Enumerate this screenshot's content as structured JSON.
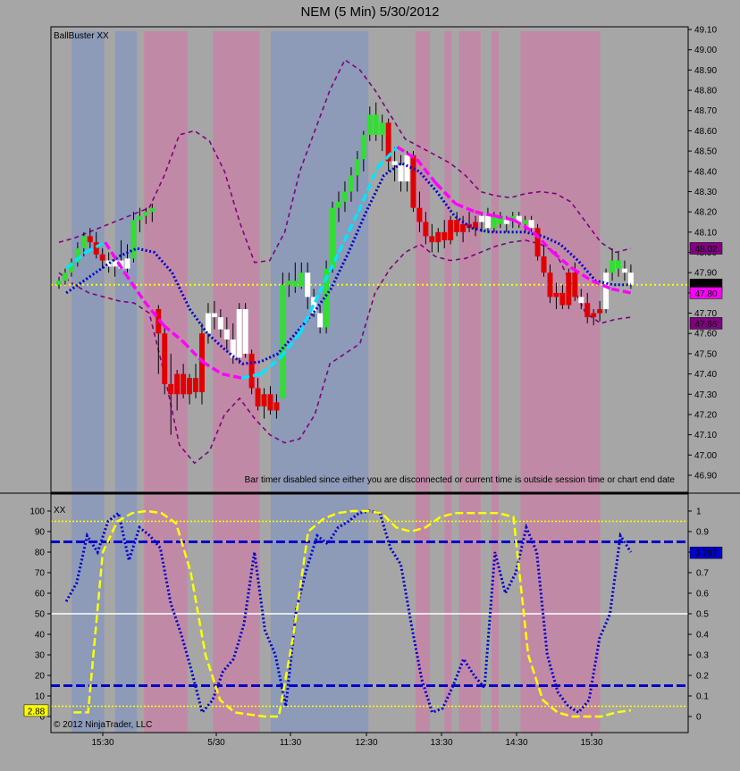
{
  "window": {
    "title": "NEM (5 Min)  5/30/2012"
  },
  "colors": {
    "background": "#a6a6a6",
    "band_blue": "#8d9ab8",
    "band_red": "#c08aa6",
    "candle_up_green": "#33dd33",
    "candle_down_red": "#e00000",
    "candle_neutral_white": "#ffffff",
    "bollinger_purple": "#800080",
    "ma_magenta": "#ff00ff",
    "ma_cyan": "#00e5ff",
    "ma_blue": "#0000cc",
    "price_line_yellow": "#ffff00",
    "oscillator_yellow": "#ffff00",
    "oscillator_blue": "#0000cc"
  },
  "chart_data": [
    {
      "type": "candlestick",
      "label": "BallBuster XX",
      "y_axis": {
        "range": [
          46.8,
          49.1
        ],
        "ticks": [
          "49.10",
          "49.00",
          "48.90",
          "48.80",
          "48.70",
          "48.60",
          "48.50",
          "48.40",
          "48.30",
          "48.20",
          "48.10",
          "48.00",
          "47.90",
          "47.80",
          "47.70",
          "47.60",
          "47.50",
          "47.40",
          "47.30",
          "47.20",
          "47.10",
          "47.00",
          "46.90"
        ]
      },
      "price_labels": [
        {
          "text": "48.02",
          "value": 48.02,
          "color": "#800080"
        },
        {
          "text": "47.84",
          "value": 47.84,
          "color": "#000000"
        },
        {
          "text": "47.80",
          "value": 47.8,
          "color": "#ff00ff"
        },
        {
          "text": "47.65",
          "value": 47.65,
          "color": "#800080"
        }
      ],
      "horizontal_line": {
        "value": 47.84,
        "style": "dotted",
        "color": "#ffff00"
      },
      "note": "Bar timer disabled since either you are disconnected or current time is outside session time or chart end date",
      "session_bands": [
        {
          "from_bar": 4,
          "to_bar": 12,
          "color": "blue"
        },
        {
          "from_bar": 16,
          "to_bar": 21,
          "color": "blue"
        },
        {
          "from_bar": 24,
          "to_bar": 35,
          "color": "red"
        },
        {
          "from_bar": 43,
          "to_bar": 55,
          "color": "red"
        },
        {
          "from_bar": 59,
          "to_bar": 85,
          "color": "blue"
        },
        {
          "from_bar": 99,
          "to_bar": 102,
          "color": "red"
        },
        {
          "from_bar": 107,
          "to_bar": 108,
          "color": "red"
        },
        {
          "from_bar": 111,
          "to_bar": 116,
          "color": "red"
        },
        {
          "from_bar": 120,
          "to_bar": 121,
          "color": "red"
        },
        {
          "from_bar": 128,
          "to_bar": 149,
          "color": "red"
        }
      ],
      "candles": [
        [
          47.84,
          47.88,
          47.82,
          47.86,
          "g"
        ],
        [
          47.86,
          47.92,
          47.84,
          47.9,
          "g"
        ],
        [
          47.9,
          47.97,
          47.88,
          47.95,
          "g"
        ],
        [
          47.95,
          48.05,
          47.93,
          48.02,
          "g"
        ],
        [
          48.02,
          48.1,
          47.98,
          48.08,
          "g"
        ],
        [
          48.08,
          48.12,
          48.02,
          48.05,
          "r"
        ],
        [
          48.05,
          48.1,
          47.97,
          47.99,
          "r"
        ],
        [
          47.99,
          48.02,
          47.92,
          47.96,
          "r"
        ],
        [
          47.96,
          48.0,
          47.9,
          47.93,
          "w"
        ],
        [
          47.93,
          47.98,
          47.88,
          47.96,
          "w"
        ],
        [
          47.96,
          48.06,
          47.92,
          47.92,
          "w"
        ],
        [
          47.92,
          48.04,
          47.9,
          47.97,
          "w"
        ],
        [
          47.97,
          48.2,
          47.95,
          48.16,
          "g"
        ],
        [
          48.16,
          48.22,
          48.1,
          48.18,
          "g"
        ],
        [
          48.18,
          48.22,
          48.14,
          48.2,
          "g"
        ],
        [
          48.2,
          48.24,
          48.15,
          48.22,
          "g"
        ],
        [
          47.72,
          47.74,
          47.4,
          47.6,
          "r"
        ],
        [
          47.6,
          47.63,
          47.3,
          47.35,
          "r"
        ],
        [
          47.35,
          47.5,
          47.1,
          47.3,
          "r"
        ],
        [
          47.3,
          47.42,
          47.22,
          47.4,
          "r"
        ],
        [
          47.4,
          47.45,
          47.28,
          47.3,
          "r"
        ],
        [
          47.3,
          47.4,
          47.25,
          47.38,
          "r"
        ],
        [
          47.38,
          47.45,
          47.28,
          47.31,
          "r"
        ],
        [
          47.31,
          47.65,
          47.25,
          47.6,
          "r"
        ],
        [
          47.6,
          47.75,
          47.55,
          47.7,
          "w"
        ],
        [
          47.7,
          47.76,
          47.62,
          47.68,
          "w"
        ],
        [
          47.68,
          47.72,
          47.58,
          47.62,
          "w"
        ],
        [
          47.62,
          47.68,
          47.52,
          47.57,
          "w"
        ],
        [
          47.57,
          47.65,
          47.45,
          47.48,
          "w"
        ],
        [
          47.48,
          47.75,
          47.45,
          47.72,
          "w"
        ],
        [
          47.72,
          47.75,
          47.48,
          47.5,
          "w"
        ],
        [
          47.5,
          47.52,
          47.3,
          47.33,
          "r"
        ],
        [
          47.33,
          47.38,
          47.22,
          47.24,
          "r"
        ],
        [
          47.24,
          47.33,
          47.18,
          47.3,
          "r"
        ],
        [
          47.3,
          47.34,
          47.2,
          47.22,
          "r"
        ],
        [
          47.22,
          47.3,
          47.18,
          47.26,
          "r"
        ],
        [
          47.28,
          47.9,
          47.28,
          47.84,
          "g"
        ],
        [
          47.84,
          47.9,
          47.78,
          47.86,
          "g"
        ],
        [
          47.86,
          47.95,
          47.8,
          47.83,
          "g"
        ],
        [
          47.83,
          47.95,
          47.82,
          47.9,
          "g"
        ],
        [
          47.9,
          47.95,
          47.72,
          47.78,
          "w"
        ],
        [
          47.78,
          47.82,
          47.68,
          47.7,
          "w"
        ],
        [
          47.7,
          47.74,
          47.6,
          47.63,
          "w"
        ],
        [
          47.63,
          47.96,
          47.6,
          47.92,
          "g"
        ],
        [
          47.92,
          48.25,
          47.9,
          48.22,
          "g"
        ],
        [
          48.22,
          48.3,
          48.15,
          48.25,
          "g"
        ],
        [
          48.25,
          48.35,
          48.2,
          48.3,
          "g"
        ],
        [
          48.3,
          48.42,
          48.25,
          48.38,
          "g"
        ],
        [
          48.38,
          48.5,
          48.3,
          48.46,
          "g"
        ],
        [
          48.46,
          48.6,
          48.4,
          48.58,
          "g"
        ],
        [
          48.58,
          48.72,
          48.55,
          48.68,
          "g"
        ],
        [
          48.68,
          48.74,
          48.55,
          48.58,
          "g"
        ],
        [
          48.58,
          48.68,
          48.5,
          48.64,
          "g"
        ],
        [
          48.64,
          48.66,
          48.4,
          48.45,
          "r"
        ],
        [
          48.45,
          48.52,
          48.35,
          48.43,
          "w"
        ],
        [
          48.43,
          48.48,
          48.3,
          48.35,
          "w"
        ],
        [
          48.35,
          48.5,
          48.3,
          48.48,
          "w"
        ],
        [
          48.48,
          48.5,
          48.2,
          48.22,
          "r"
        ],
        [
          48.22,
          48.3,
          48.1,
          48.15,
          "r"
        ],
        [
          48.15,
          48.2,
          48.04,
          48.08,
          "r"
        ],
        [
          48.08,
          48.14,
          48.0,
          48.05,
          "r"
        ],
        [
          48.05,
          48.12,
          48.0,
          48.1,
          "r"
        ],
        [
          48.1,
          48.16,
          48.02,
          48.06,
          "r"
        ],
        [
          48.06,
          48.18,
          48.04,
          48.16,
          "r"
        ],
        [
          48.16,
          48.2,
          48.08,
          48.1,
          "r"
        ],
        [
          48.1,
          48.18,
          48.05,
          48.14,
          "r"
        ],
        [
          48.14,
          48.2,
          48.1,
          48.12,
          "r"
        ],
        [
          48.12,
          48.18,
          48.08,
          48.15,
          "r"
        ],
        [
          48.15,
          48.2,
          48.1,
          48.18,
          "w"
        ],
        [
          48.18,
          48.22,
          48.1,
          48.12,
          "w"
        ],
        [
          48.12,
          48.2,
          48.1,
          48.18,
          "g"
        ],
        [
          48.18,
          48.2,
          48.12,
          48.14,
          "g"
        ],
        [
          48.14,
          48.18,
          48.1,
          48.16,
          "w"
        ],
        [
          48.16,
          48.2,
          48.12,
          48.18,
          "g"
        ],
        [
          48.18,
          48.2,
          48.12,
          48.14,
          "w"
        ],
        [
          48.14,
          48.18,
          48.1,
          48.16,
          "g"
        ],
        [
          48.16,
          48.18,
          48.1,
          48.12,
          "w"
        ],
        [
          48.12,
          48.14,
          47.96,
          47.98,
          "r"
        ],
        [
          47.98,
          48.04,
          47.88,
          47.9,
          "r"
        ],
        [
          47.9,
          47.94,
          47.75,
          47.78,
          "r"
        ],
        [
          47.78,
          47.85,
          47.72,
          47.8,
          "r"
        ],
        [
          47.8,
          47.84,
          47.72,
          47.74,
          "r"
        ],
        [
          47.74,
          47.92,
          47.72,
          47.9,
          "r"
        ],
        [
          47.9,
          47.95,
          47.76,
          47.78,
          "r"
        ],
        [
          47.78,
          47.82,
          47.72,
          47.75,
          "w"
        ],
        [
          47.75,
          47.8,
          47.65,
          47.68,
          "r"
        ],
        [
          47.68,
          47.72,
          47.64,
          47.7,
          "r"
        ],
        [
          47.7,
          47.76,
          47.66,
          47.72,
          "r"
        ],
        [
          47.72,
          47.92,
          47.7,
          47.9,
          "w"
        ],
        [
          47.9,
          48.02,
          47.86,
          47.96,
          "g"
        ],
        [
          47.96,
          48.0,
          47.88,
          47.92,
          "g"
        ],
        [
          47.92,
          47.96,
          47.86,
          47.9,
          "w"
        ],
        [
          47.9,
          47.94,
          47.82,
          47.84,
          "w"
        ]
      ],
      "bollinger_upper": [
        48.05,
        48.07,
        48.1,
        48.13,
        48.16,
        48.19,
        48.22,
        48.38,
        48.58,
        48.6,
        48.55,
        48.4,
        48.15,
        47.95,
        47.96,
        48.1,
        48.4,
        48.6,
        48.8,
        48.95,
        48.9,
        48.8,
        48.68,
        48.56,
        48.52,
        48.48,
        48.44,
        48.38,
        48.3,
        48.28,
        48.27,
        48.29,
        48.3,
        48.29,
        48.25,
        48.15,
        48.05,
        48.0,
        48.02
      ],
      "bollinger_lower": [
        47.9,
        47.84,
        47.8,
        47.78,
        47.76,
        47.75,
        47.7,
        47.4,
        47.05,
        46.96,
        47.02,
        47.2,
        47.28,
        47.18,
        47.1,
        47.06,
        47.08,
        47.2,
        47.45,
        47.5,
        47.55,
        47.8,
        47.92,
        48.0,
        48.04,
        47.98,
        47.96,
        47.97,
        48.0,
        48.03,
        48.05,
        48.06,
        48.04,
        48.0,
        47.85,
        47.7,
        47.65,
        47.67,
        47.68
      ],
      "ma_blue": [
        47.8,
        47.86,
        47.92,
        47.98,
        48.02,
        48.0,
        47.9,
        47.72,
        47.6,
        47.52,
        47.45,
        47.46,
        47.5,
        47.6,
        47.7,
        47.82,
        48.0,
        48.2,
        48.38,
        48.44,
        48.4,
        48.3,
        48.18,
        48.12,
        48.1,
        48.1,
        48.1,
        48.08,
        48.04,
        47.96,
        47.86,
        47.84,
        47.84
      ],
      "ma_pink": [
        47.92,
        48.0,
        48.05,
        47.9,
        47.76,
        47.64,
        47.56,
        47.46,
        47.4,
        47.38,
        47.4,
        47.48,
        47.6,
        47.8,
        48.0,
        48.2,
        48.42,
        48.52,
        48.46,
        48.34,
        48.24,
        48.2,
        48.18,
        48.16,
        48.1,
        48.0,
        47.92,
        47.86,
        47.82,
        47.8
      ]
    },
    {
      "type": "line",
      "label": "XX",
      "left_axis": {
        "range": [
          0,
          100
        ],
        "ticks": [
          "100",
          "90",
          "80",
          "70",
          "60",
          "50",
          "40",
          "30",
          "20",
          "10",
          "0"
        ]
      },
      "right_axis": {
        "range": [
          0,
          1
        ],
        "ticks": [
          "1",
          "0.9",
          "0.8",
          "0.7",
          "0.6",
          "0.5",
          "0.4",
          "0.3",
          "0.2",
          "0.1",
          "0"
        ]
      },
      "value_labels": [
        {
          "text": "0.797",
          "value": 0.797,
          "color": "#0000cc",
          "side": "right"
        },
        {
          "text": "2.88",
          "value": 2.88,
          "color": "#ffff00",
          "side": "left"
        }
      ],
      "lines": [
        {
          "value": 95,
          "style": "dotted",
          "color": "#ffff00"
        },
        {
          "value": 85,
          "style": "dashed",
          "color": "#0000cc"
        },
        {
          "value": 50,
          "style": "solid",
          "color": "#ffffff"
        },
        {
          "value": 15,
          "style": "dashed",
          "color": "#0000cc"
        },
        {
          "value": 5,
          "style": "dotted",
          "color": "#ffff00"
        }
      ],
      "series_blue": [
        56,
        65,
        88,
        80,
        95,
        99,
        76,
        92,
        88,
        82,
        55,
        40,
        22,
        2,
        8,
        22,
        28,
        45,
        80,
        42,
        30,
        5,
        52,
        72,
        88,
        84,
        92,
        95,
        99,
        100,
        99,
        82,
        74,
        45,
        18,
        2,
        4,
        15,
        28,
        20,
        14,
        80,
        60,
        70,
        92,
        80,
        30,
        12,
        5,
        2,
        8,
        38,
        50,
        88,
        80
      ],
      "series_yellow": [
        2,
        2,
        80,
        95,
        99,
        100,
        99,
        94,
        70,
        30,
        8,
        2,
        1,
        0,
        0,
        40,
        90,
        96,
        99,
        100,
        100,
        99,
        92,
        90,
        92,
        97,
        99,
        99,
        99,
        99,
        97,
        30,
        8,
        2,
        0,
        0,
        0,
        2,
        3
      ]
    }
  ],
  "x_axis": {
    "labels": [
      "15:30",
      "5/30",
      "11:30",
      "12:30",
      "13:30",
      "14:30",
      "15:30"
    ]
  },
  "footer": {
    "copyright": "© 2012 NinjaTrader, LLC"
  }
}
